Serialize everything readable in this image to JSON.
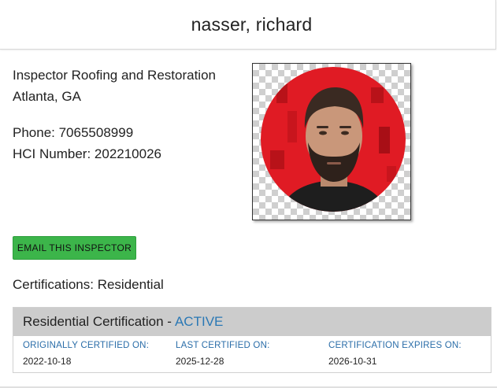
{
  "header": {
    "title": "nasser, richard"
  },
  "inspector": {
    "company": "Inspector Roofing and Restoration",
    "location": "Atlanta, GA",
    "phone": "Phone: 7065508999",
    "hci_number": "HCI Number: 202210026"
  },
  "photo": {
    "icon": "inspector-avatar",
    "background_color": "#e01b24"
  },
  "actions": {
    "email_label": "EMAIL THIS INSPECTOR"
  },
  "certifications": {
    "summary": "Certifications: Residential",
    "cards": [
      {
        "name": "Residential Certification - ",
        "status": "ACTIVE",
        "fields": [
          {
            "label": "ORIGINALLY CERTIFIED ON:",
            "value": "2022-10-18"
          },
          {
            "label": "LAST CERTIFIED ON:",
            "value": "2025-12-28"
          },
          {
            "label": "CERTIFICATION EXPIRES ON:",
            "value": "2026-10-31"
          }
        ]
      }
    ]
  },
  "colors": {
    "accent_green": "#3cb54a",
    "status_blue": "#2a78b5",
    "card_header_gray": "#cccccc"
  }
}
